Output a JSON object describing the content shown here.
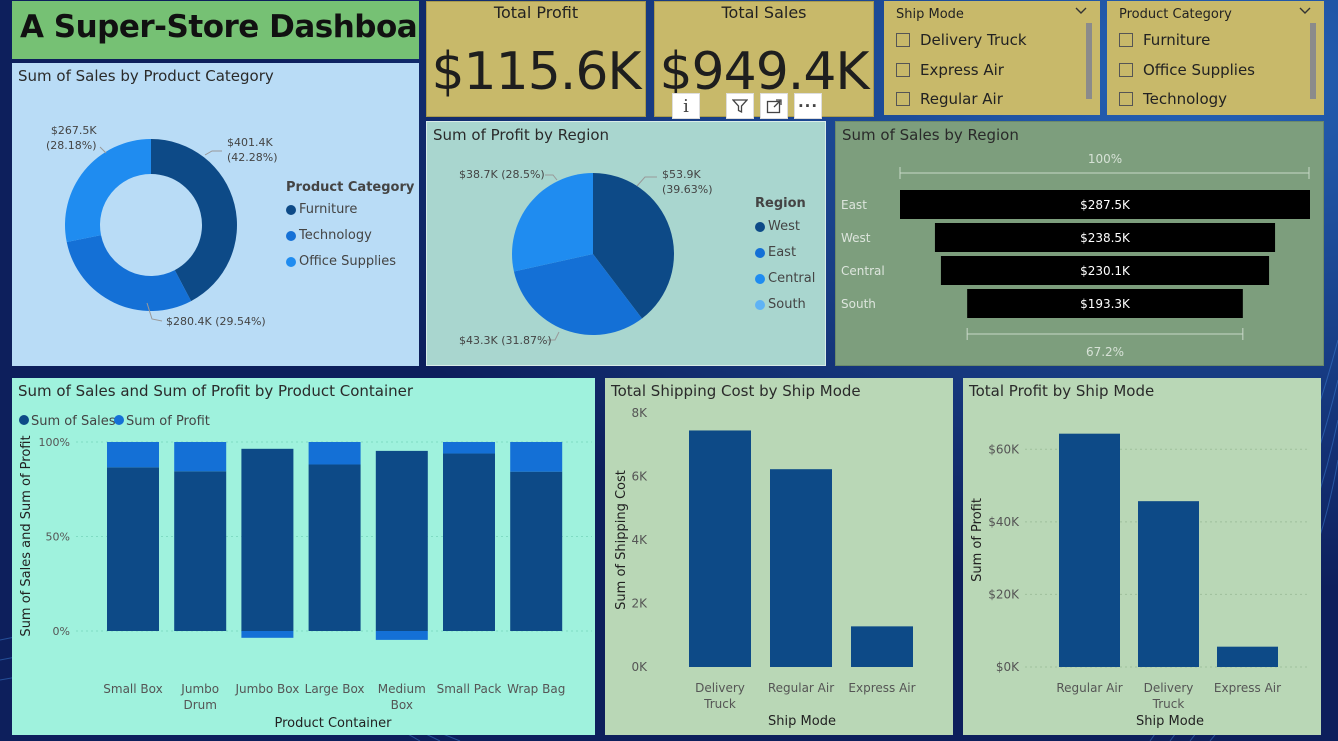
{
  "dashboard_title": "A Super-Store Dashboard",
  "kpis": {
    "profit": {
      "label": "Total Profit",
      "value": "$115.6K"
    },
    "sales": {
      "label": "Total Sales",
      "value": "$949.4K"
    }
  },
  "slicers": {
    "ship_mode": {
      "header": "Ship Mode",
      "options": [
        "Delivery Truck",
        "Express Air",
        "Regular Air"
      ]
    },
    "product_category": {
      "header": "Product Category",
      "options": [
        "Furniture",
        "Office Supplies",
        "Technology"
      ]
    }
  },
  "toolbar": {
    "info_icon": "info-icon",
    "filter_icon": "filter-icon",
    "focus_icon": "focus-mode-icon",
    "more_icon": "more-options-icon"
  },
  "colors": {
    "dark_blue": "#0d4a87",
    "mid_blue": "#1470d6",
    "bright_blue": "#1f8cf0",
    "light_blue": "#5fb3f5",
    "black_bar": "#000000"
  },
  "chart_data": [
    {
      "type": "pie",
      "variant": "donut",
      "title": "Sum of Sales by Product Category",
      "legend_title": "Product Category",
      "categories": [
        "Furniture",
        "Technology",
        "Office Supplies"
      ],
      "values": [
        401.4,
        280.4,
        267.5
      ],
      "labels": [
        "$401.4K\n(42.28%)",
        "$280.4K (29.54%)",
        "$267.5K\n(28.18%)"
      ],
      "legend": "right"
    },
    {
      "type": "pie",
      "title": "Sum of Profit by Region",
      "legend_title": "Region",
      "categories": [
        "West",
        "East",
        "Central",
        "South"
      ],
      "values": [
        53.9,
        43.3,
        38.7
      ],
      "labels": [
        "$53.9K\n(39.63%)",
        "$43.3K (31.87%)",
        "$38.7K (28.5%)"
      ],
      "legend": "right"
    },
    {
      "type": "bar",
      "variant": "funnel",
      "title": "Sum of Sales by Region",
      "categories": [
        "East",
        "West",
        "Central",
        "South"
      ],
      "values": [
        287.5,
        238.5,
        230.1,
        193.3
      ],
      "labels": [
        "$287.5K",
        "$238.5K",
        "$230.1K",
        "$193.3K"
      ],
      "top_label": "100%",
      "bottom_label": "67.2%"
    },
    {
      "type": "bar",
      "variant": "100% stacked column",
      "title": "Sum of Sales and Sum of Profit by Product Container",
      "xlabel": "Product Container",
      "ylabel": "Sum of Sales and Sum of Profit",
      "categories": [
        "Small Box",
        "Jumbo Drum",
        "Jumbo Box",
        "Large Box",
        "Medium Box",
        "Small Pack",
        "Wrap Bag"
      ],
      "series": [
        {
          "name": "Sum of Sales",
          "values": [
            86.6,
            84.5,
            96.4,
            88.1,
            95.3,
            93.9,
            84.3
          ]
        },
        {
          "name": "Sum of Profit",
          "values": [
            13.4,
            15.5,
            -3.6,
            11.9,
            -4.7,
            6.1,
            15.7
          ]
        }
      ],
      "yticks": [
        "100%",
        "50%",
        "0%"
      ],
      "ylim": [
        -5,
        100
      ],
      "legend": "top-left"
    },
    {
      "type": "bar",
      "title": "Total Shipping Cost by Ship Mode",
      "xlabel": "Ship Mode",
      "ylabel": "Sum of Shipping Cost",
      "categories": [
        "Delivery Truck",
        "Regular Air",
        "Express Air"
      ],
      "values": [
        7450,
        6230,
        1280
      ],
      "yticks": [
        "8K",
        "6K",
        "4K",
        "2K",
        "0K"
      ],
      "ylim": [
        0,
        8000
      ]
    },
    {
      "type": "bar",
      "title": "Total Profit by Ship Mode",
      "xlabel": "Ship Mode",
      "ylabel": "Sum of Profit",
      "categories": [
        "Regular Air",
        "Delivery Truck",
        "Express Air"
      ],
      "values": [
        64300,
        45700,
        5600
      ],
      "yticks": [
        "$60K",
        "$40K",
        "$20K",
        "$0K"
      ],
      "ylim": [
        0,
        70000
      ]
    }
  ]
}
